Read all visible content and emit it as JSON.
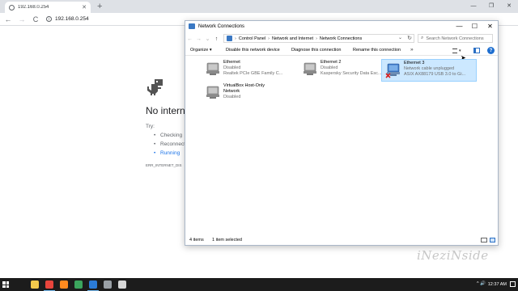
{
  "browser": {
    "tab_title": "192.168.0.254",
    "new_tab": "+",
    "url": "192.168.0.254",
    "window_controls": {
      "minimize": "—",
      "maximize": "❐",
      "close": "✕"
    },
    "nav": {
      "back": "←",
      "forward": "→",
      "reload": "C"
    }
  },
  "error_page": {
    "title": "No internet",
    "try_label": "Try:",
    "suggestions": [
      "Checking",
      "Reconnect",
      "Running"
    ],
    "error_code": "ERR_INTERNET_DIS"
  },
  "netwin": {
    "title": "Network Connections",
    "controls": {
      "minimize": "—",
      "maximize": "☐",
      "close": "✕"
    },
    "nav": {
      "back": "←",
      "forward": "→",
      "recent": "⌄",
      "up": "↑"
    },
    "breadcrumbs": [
      "Control Panel",
      "Network and Internet",
      "Network Connections"
    ],
    "crumb_sep": "›",
    "address_dropdown": "⌄",
    "refresh": "↻",
    "search_placeholder": "Search Network Connections",
    "search_glyph": "⌕",
    "commands": {
      "organize": "Organize ▾",
      "disable": "Disable this network device",
      "diagnose": "Diagnose this connection",
      "rename": "Rename this connection",
      "more": "»",
      "view_dropdown": "▾",
      "help": "?"
    },
    "connections": [
      {
        "name": "Ethernet",
        "status": "Disabled",
        "device": "Realtek PCIe GBE Family C..."
      },
      {
        "name": "Ethernet 2",
        "status": "Disabled",
        "device": "Kaspersky Security Data Esc..."
      },
      {
        "name": "Ethernet 3",
        "status": "Network cable unplugged",
        "device": "ASIX AX88179 USB 3.0 to Gi...",
        "selected": true
      },
      {
        "name": "VirtualBox Host-Only",
        "name2": "Network",
        "status": "Disabled"
      }
    ],
    "status_bar": {
      "count": "4 items",
      "selection": "1 item selected"
    }
  },
  "taskbar": {
    "tray": "^ 🔊",
    "time": "12:37 AM",
    "apps": [
      {
        "name": "file-explorer",
        "color": "#f2c94c"
      },
      {
        "name": "chrome",
        "color": "#e8453c"
      },
      {
        "name": "firefox",
        "color": "#ff8a1f"
      },
      {
        "name": "app-green",
        "color": "#3ba55d"
      },
      {
        "name": "app-blue",
        "color": "#2b7bd6"
      },
      {
        "name": "app-gray",
        "color": "#9aa0a6"
      },
      {
        "name": "app-light",
        "color": "#d7d7d7"
      }
    ]
  },
  "watermark": "iNeziNside"
}
